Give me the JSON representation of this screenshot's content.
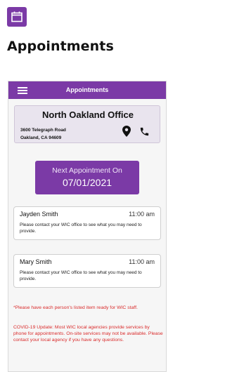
{
  "page": {
    "icon": "calendar-icon",
    "title": "Appointments"
  },
  "app": {
    "bar_title": "Appointments",
    "menu_icon": "hamburger-menu-icon",
    "accent_color": "#7b3aa6",
    "warning_color": "#d92b2b"
  },
  "office": {
    "name": "North Oakland Office",
    "address_line1": "3600 Telegraph Road",
    "address_line2": "Oakland, CA 94609",
    "map_icon": "map-pin-icon",
    "call_icon": "phone-icon"
  },
  "next_appointment": {
    "label": "Next Appointment On",
    "date": "07/01/2021"
  },
  "appointments": [
    {
      "name": "Jayden Smith",
      "time": "11:00 am",
      "note": "Please contact your WIC office to see what you may need to provide."
    },
    {
      "name": "Mary Smith",
      "time": "11:00 am",
      "note": "Please contact your WIC office to see what you may need to provide."
    }
  ],
  "notes": {
    "items_reminder": "*Please have each person's listed item ready for WIC staff.",
    "covid_update": "COVID-19 Update: Most WIC local agencies provide services by phone for appointments. On-site services may not be available. Please contact your local agency if you have any questions."
  }
}
